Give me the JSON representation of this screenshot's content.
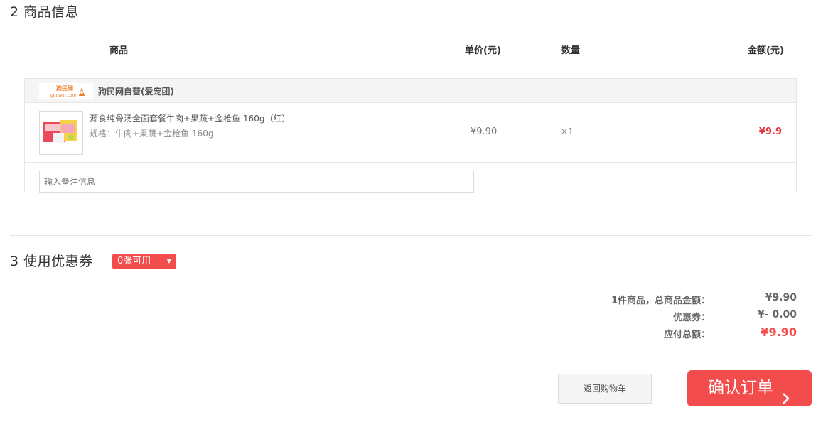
{
  "sections": {
    "goods_title": "2 商品信息",
    "coupon_title": "3 使用优惠券"
  },
  "table": {
    "headers": {
      "product": "商品",
      "unit_price": "单价(元)",
      "quantity": "数量",
      "amount": "金额(元)"
    }
  },
  "shop": {
    "name": "狗民网自营(爱宠团)",
    "logo_text_top": "狗民网",
    "logo_text_bottom": "gouwin.com"
  },
  "item": {
    "name": "源食纯骨汤全面套餐牛肉+果蔬+金枪鱼 160g（红）",
    "spec": "规格：牛肉+果蔬+金枪鱼 160g",
    "unit_price": "¥9.90",
    "quantity": "×1",
    "amount": "¥9.9"
  },
  "note": {
    "placeholder": "输入备注信息"
  },
  "coupon": {
    "selected": "0张可用"
  },
  "summary": {
    "total_label": "1件商品，总商品金额：",
    "total_value": "¥9.90",
    "coupon_label": "优惠券：",
    "coupon_value": "¥- 0.00",
    "payable_label": "应付总额：",
    "payable_value": "¥9.90"
  },
  "buttons": {
    "back": "返回购物车",
    "confirm": "确认订单"
  },
  "colors": {
    "accent": "#f24c4c",
    "price_red": "#e4393c"
  },
  "icons": {
    "coupon_dropdown": "caret-down-icon",
    "confirm_arrow": "chevron-right-icon"
  }
}
